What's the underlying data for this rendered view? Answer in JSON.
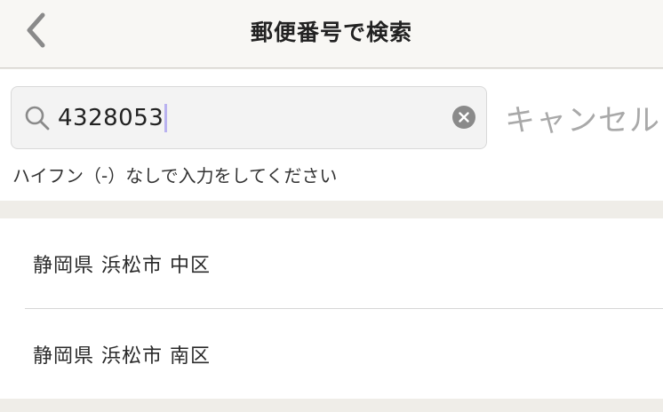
{
  "nav": {
    "title": "郵便番号で検索",
    "back_icon": "chevron-left-icon"
  },
  "search": {
    "value": "4328053",
    "cancel_label": "キャンセル",
    "hint": "ハイフン（-）なしで入力をしてください"
  },
  "results": [
    {
      "label": "静岡県 浜松市 中区"
    },
    {
      "label": "静岡県 浜松市 南区"
    }
  ],
  "colors": {
    "background": "#efede8",
    "nav_background": "#f8f7f4",
    "cancel_text": "#a9a9a9",
    "caret": "#b9b2f0"
  }
}
